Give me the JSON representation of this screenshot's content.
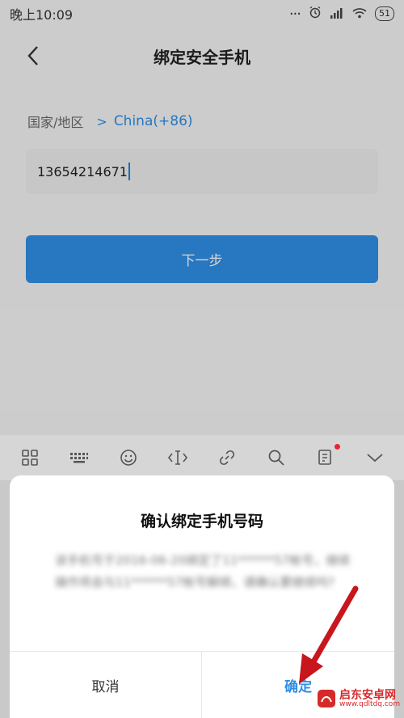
{
  "status_bar": {
    "time": "晚上10:09",
    "battery": "51"
  },
  "nav": {
    "title": "绑定安全手机"
  },
  "region": {
    "label": "国家/地区",
    "chevron": ">",
    "value": "China(+86)"
  },
  "phone": {
    "value": "13654214671"
  },
  "next_button": {
    "label": "下一步"
  },
  "keyboard_toolbar": {
    "icons": [
      "grid-icon",
      "keyboard-icon",
      "emoji-icon",
      "cursor-icon",
      "link-icon",
      "search-icon",
      "clipboard-icon",
      "chevron-down-icon"
    ]
  },
  "dialog": {
    "title": "确认绑定手机号码",
    "message": "该手机号于2016-06-20绑定了11******57帐号，继续操作将会与11******57帐号解绑，请确认要继续吗?",
    "cancel_label": "取消",
    "confirm_label": "确定"
  },
  "watermark": {
    "text": "启东安卓网",
    "subtext": "www.qdltdq.com"
  },
  "colors": {
    "accent": "#2f8ee6",
    "arrow": "#c8161d"
  }
}
